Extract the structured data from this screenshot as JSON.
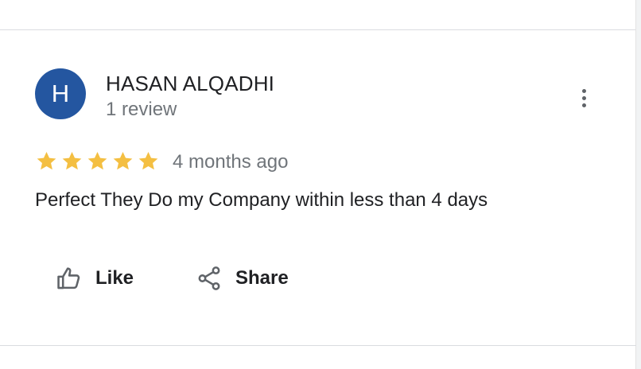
{
  "review": {
    "author_name": "HASAN ALQADHI",
    "avatar_initial": "H",
    "review_count": "1 review",
    "rating": 5,
    "time": "4 months ago",
    "text": "Perfect They Do my Company within less than 4 days"
  },
  "actions": {
    "like_label": "Like",
    "share_label": "Share"
  },
  "colors": {
    "avatar_bg": "#2456a0",
    "star": "#f4bf42",
    "text_primary": "#202124",
    "text_secondary": "#70757a"
  },
  "icons": {
    "more": "more-vert-icon",
    "like": "thumbs-up-icon",
    "share": "share-icon",
    "star": "star-icon"
  }
}
